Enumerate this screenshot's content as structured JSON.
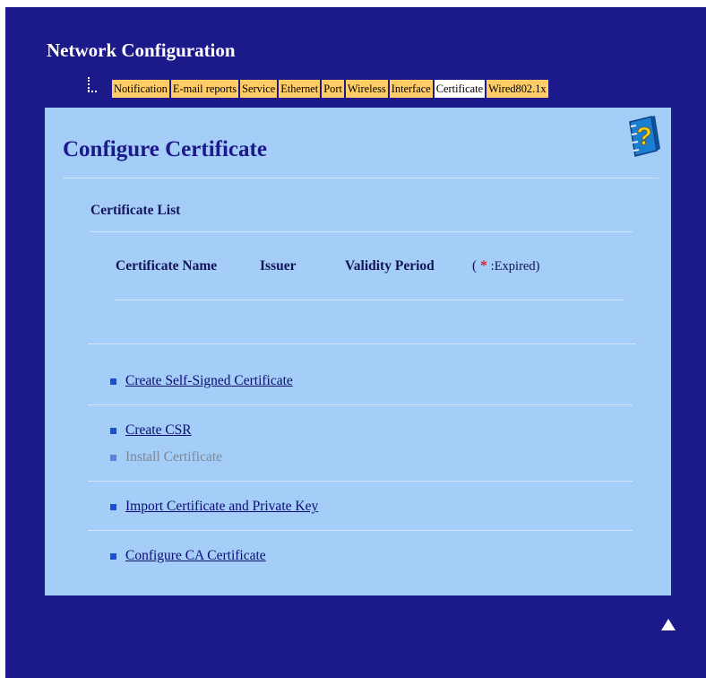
{
  "header": {
    "title": "Network Configuration"
  },
  "tabs": [
    {
      "label": "Notification",
      "active": false
    },
    {
      "label": "E-mail reports",
      "active": false
    },
    {
      "label": "Service",
      "active": false
    },
    {
      "label": "Ethernet",
      "active": false
    },
    {
      "label": "Port",
      "active": false
    },
    {
      "label": "Wireless",
      "active": false
    },
    {
      "label": "Interface",
      "active": false
    },
    {
      "label": "Certificate",
      "active": true
    },
    {
      "label": "Wired802.1x",
      "active": false
    }
  ],
  "page": {
    "title": "Configure Certificate",
    "help_icon": "help-book-icon"
  },
  "certificate_list": {
    "heading": "Certificate List",
    "columns": {
      "name": "Certificate Name",
      "issuer": "Issuer",
      "validity": "Validity Period",
      "legend_open": "(",
      "legend_star": "*",
      "legend_text": ":Expired)"
    }
  },
  "actions": {
    "create_self_signed": "Create Self-Signed Certificate",
    "create_csr": "Create CSR",
    "install_certificate": "Install Certificate",
    "import_cert_key": "Import Certificate and Private Key",
    "configure_ca": "Configure CA Certificate"
  },
  "colors": {
    "background": "#1c1a8a",
    "panel": "#a4cdf7",
    "tab": "#ffcc66",
    "tab_active": "#ffffff",
    "link": "#0c0c74",
    "expired_star": "#e81f1f"
  },
  "icons": {
    "back_to_top": "up-arrow-icon"
  }
}
